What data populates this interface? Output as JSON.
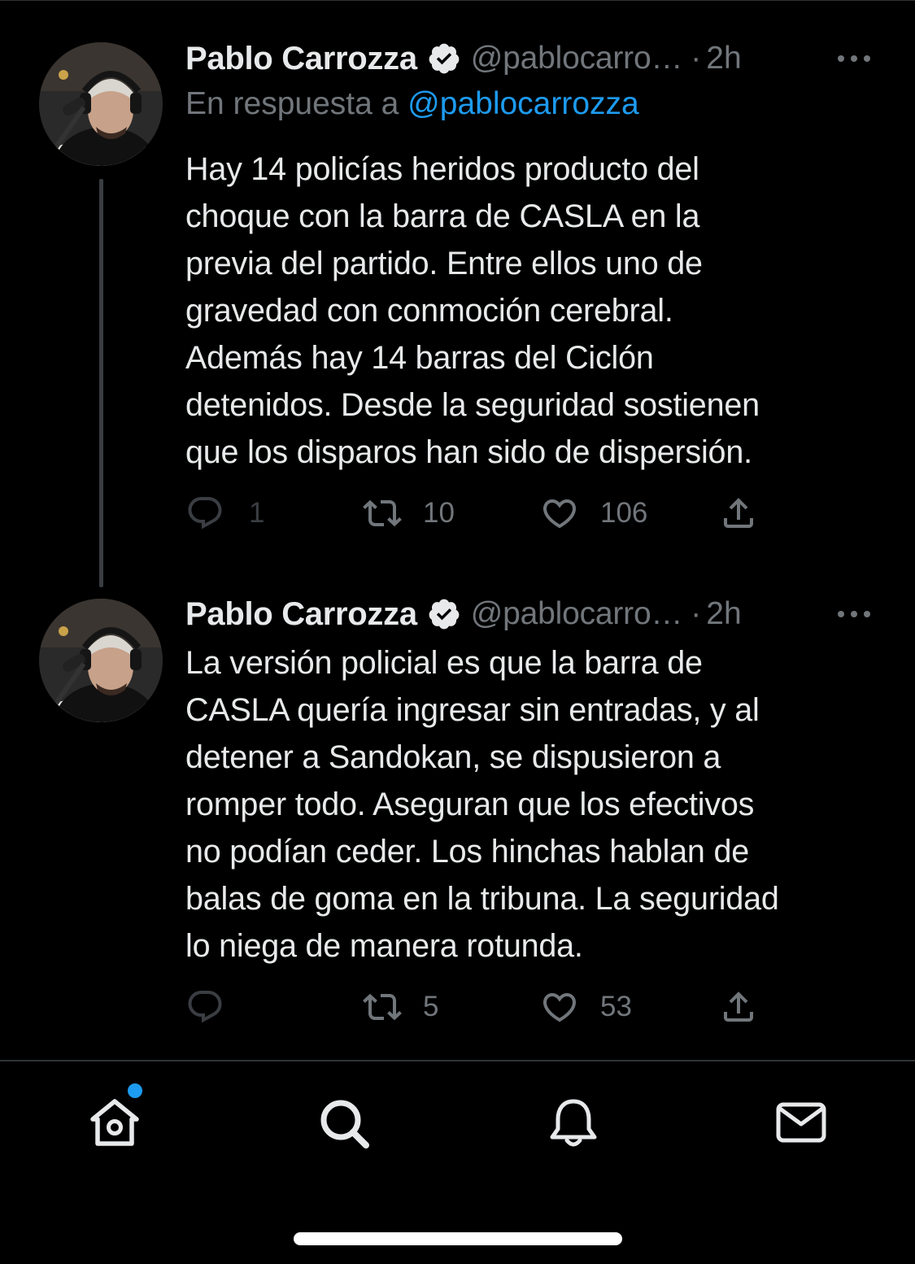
{
  "tweets": [
    {
      "author": {
        "display_name": "Pablo Carrozza",
        "handle": "@pablocarro…",
        "verified": true
      },
      "separator": "·",
      "time": "2h",
      "reply_prefix": "En respuesta a ",
      "reply_to": "@pablocarrozza",
      "text": "Hay 14 policías heridos producto del\nchoque con la barra de CASLA en la\nprevia del partido. Entre ellos uno de\ngravedad con conmoción cerebral.\nAdemás hay 14 barras del Ciclón\ndetenidos. Desde la seguridad sostienen\nque los disparos han sido de dispersión.",
      "replies": "1",
      "retweets": "10",
      "likes": "106"
    },
    {
      "author": {
        "display_name": "Pablo Carrozza",
        "handle": "@pablocarro…",
        "verified": true
      },
      "separator": "·",
      "time": "2h",
      "text": "La versión policial es que la barra de\nCASLA quería ingresar sin entradas, y al\ndetener a Sandokan, se dispusieron a\nromper todo. Aseguran que los efectivos\nno podían ceder. Los hinchas hablan de\nbalas de goma en la tribuna. La seguridad\nlo niega de manera rotunda.",
      "replies": "",
      "retweets": "5",
      "likes": "53"
    }
  ],
  "icons": {
    "more": "more-horizontal-icon",
    "reply": "reply-icon",
    "retweet": "retweet-icon",
    "like": "heart-icon",
    "share": "share-icon",
    "verified": "verified-badge-icon"
  },
  "bottom_nav": {
    "items": [
      "home-icon",
      "search-icon",
      "notifications-icon",
      "messages-icon"
    ],
    "home_has_notification": true
  },
  "colors": {
    "background": "#000000",
    "text": "#e7e9ea",
    "secondary": "#71767b",
    "accent": "#1d9bf0"
  }
}
